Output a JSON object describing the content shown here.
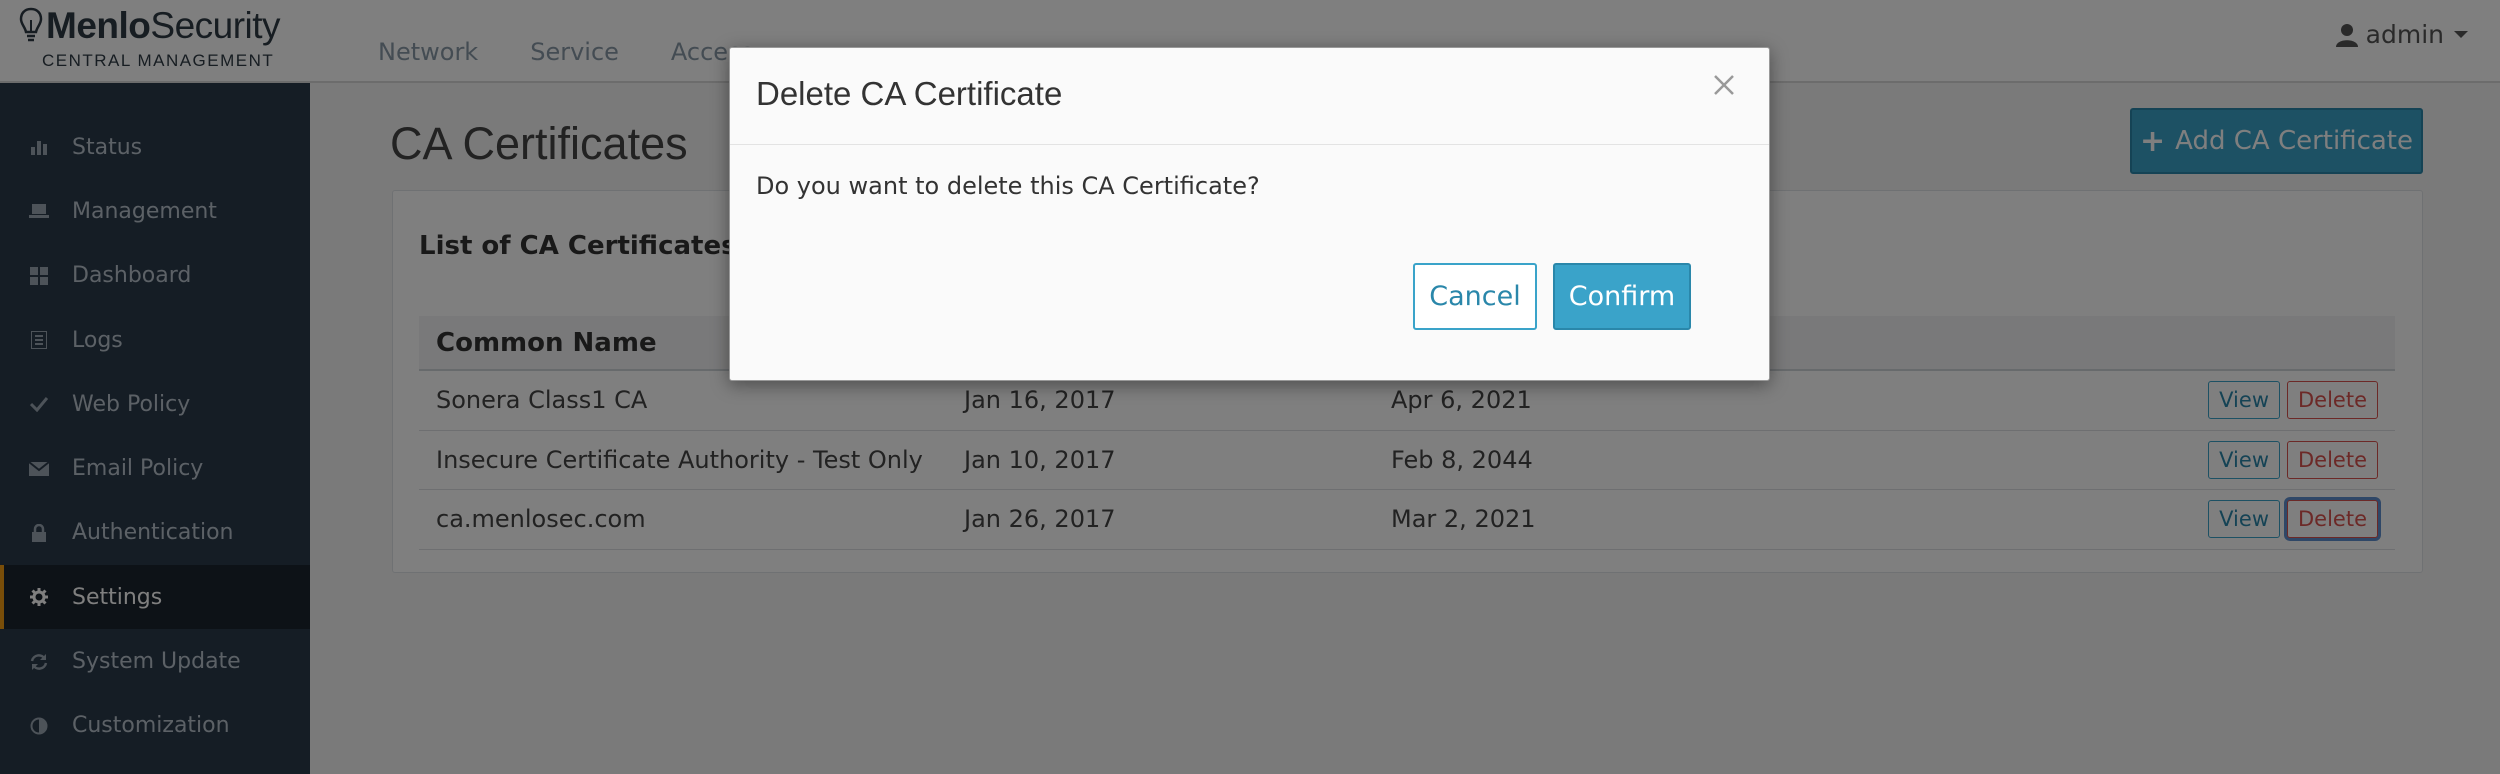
{
  "brand": {
    "logo_bold": "Menlo",
    "logo_light": "Security",
    "tagline": "CENTRAL MANAGEMENT",
    "icon": "lightbulb-icon"
  },
  "sidebar": {
    "items": [
      {
        "label": "Status",
        "icon": "bar-chart-icon"
      },
      {
        "label": "Management",
        "icon": "laptop-icon"
      },
      {
        "label": "Dashboard",
        "icon": "grid-icon"
      },
      {
        "label": "Logs",
        "icon": "list-icon"
      },
      {
        "label": "Web Policy",
        "icon": "check-icon"
      },
      {
        "label": "Email Policy",
        "icon": "envelope-icon"
      },
      {
        "label": "Authentication",
        "icon": "lock-icon"
      },
      {
        "label": "Settings",
        "icon": "gear-icon",
        "active": true
      },
      {
        "label": "System Update",
        "icon": "refresh-icon"
      },
      {
        "label": "Customization",
        "icon": "contrast-icon"
      }
    ],
    "active_accent": "#f39c12"
  },
  "topnav": {
    "items": [
      "Network",
      "Service",
      "Access"
    ]
  },
  "user": {
    "name": "admin",
    "icon": "user-icon"
  },
  "main": {
    "title": "CA Certificates",
    "add_button": "Add CA Certificate",
    "panel_title": "List of CA Certificates",
    "columns": [
      "Common Name"
    ],
    "rows": [
      {
        "name": "Sonera Class1 CA",
        "date1": "Jan 16, 2017",
        "date2": "Apr 6, 2021",
        "view": "View",
        "delete": "Delete"
      },
      {
        "name": "Insecure Certificate Authority - Test Only",
        "date1": "Jan 10, 2017",
        "date2": "Feb 8, 2044",
        "view": "View",
        "delete": "Delete"
      },
      {
        "name": "ca.menlosec.com",
        "date1": "Jan 26, 2017",
        "date2": "Mar 2, 2021",
        "view": "View",
        "delete": "Delete"
      }
    ]
  },
  "modal": {
    "title": "Delete CA Certificate",
    "message": "Do you want to delete this CA Certificate?",
    "cancel": "Cancel",
    "confirm": "Confirm"
  },
  "colors": {
    "primary": "#3aa3c9",
    "danger": "#d9534f",
    "sidebar": "#2a3a4b"
  }
}
